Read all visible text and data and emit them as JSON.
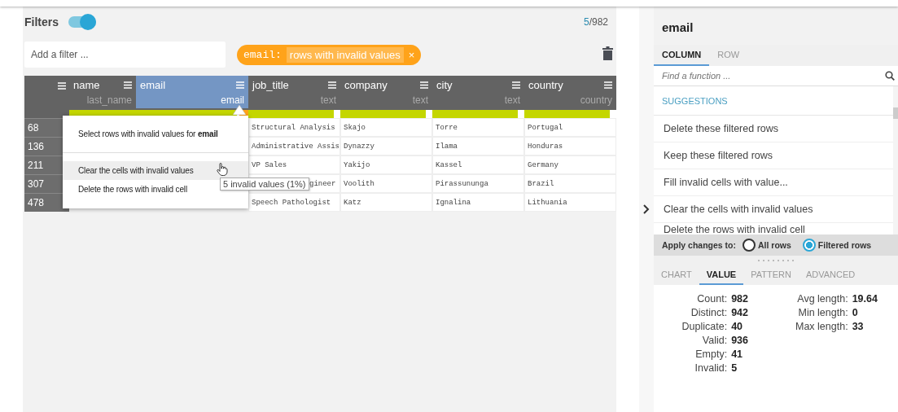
{
  "filters": {
    "label": "Filters",
    "on": true,
    "matched": "5",
    "total": "/982",
    "input": {
      "placeholder": "Add a filter ..."
    },
    "chips": [
      {
        "column": "email:",
        "value": "rows with invalid values",
        "close": "×"
      }
    ]
  },
  "table": {
    "columns": [
      {
        "name": "name",
        "type": "last_name",
        "selected": false,
        "valid": {
          "level": 1
        }
      },
      {
        "name": "email",
        "type": "email",
        "selected": true,
        "valid": {
          "level": 0.9
        },
        "invalid": {
          "level": 0.08
        }
      },
      {
        "name": "job_title",
        "type": "text",
        "selected": false,
        "valid": {
          "level": 0.93
        }
      },
      {
        "name": "company",
        "type": "text",
        "selected": false,
        "valid": {
          "level": 0.93
        }
      },
      {
        "name": "city",
        "type": "text",
        "selected": false,
        "valid": {
          "level": 0.93
        }
      },
      {
        "name": "country",
        "type": "country",
        "selected": false,
        "valid": {
          "level": 0.93
        }
      }
    ],
    "rows": [
      {
        "index": "68",
        "cells": [
          "",
          "",
          "Structural Analysis",
          "Skajo",
          "Torre",
          "Portugal"
        ],
        "under_tooltip": false
      },
      {
        "index": "136",
        "cells": [
          "",
          "",
          "Administrative Assis",
          "Dynazzy",
          "Ilama",
          "Honduras"
        ],
        "under_tooltip": false
      },
      {
        "index": "211",
        "cells": [
          "",
          "",
          "VP Sales",
          "Yakijo",
          "Kassel",
          "Germany"
        ],
        "under_tooltip": false
      },
      {
        "index": "307",
        "cells": [
          "",
          "",
          "gineer",
          "Voolith",
          "Pirassununga",
          "Brazil"
        ],
        "under_tooltip": true
      },
      {
        "index": "478",
        "cells": [
          "",
          "",
          "Speech Pathologist",
          "Katz",
          "Ignalina",
          "Lithuania"
        ],
        "under_tooltip": false
      }
    ]
  },
  "menu": {
    "items": [
      {
        "text": "Select rows with invalid values for **email**",
        "hovered": false,
        "separator_after": true
      },
      {
        "text": "Clear the cells with invalid values",
        "hovered": true,
        "separator_after": false
      },
      {
        "text": "Delete the rows with invalid cell",
        "hovered": false,
        "separator_after": false
      }
    ],
    "tooltip": "5 invalid values (1%)"
  },
  "panel": {
    "title": "email",
    "tabs": [
      {
        "label": "COLUMN",
        "selected": true
      },
      {
        "label": "ROW",
        "selected": false
      }
    ],
    "search": {
      "placeholder": "Find a function ..."
    },
    "suggestions_header": "SUGGESTIONS",
    "suggestions": [
      "Delete these filtered rows",
      "Keep these filtered rows",
      "Fill invalid cells with value...",
      "Clear the cells with invalid values",
      "Delete the rows with invalid cell"
    ],
    "apply": {
      "label": "Apply changes to:",
      "options": [
        {
          "label": "All rows",
          "selected": false
        },
        {
          "label": "Filtered rows",
          "selected": true
        }
      ]
    },
    "stat_tabs": [
      {
        "label": "CHART",
        "selected": false
      },
      {
        "label": "VALUE",
        "selected": true
      },
      {
        "label": "PATTERN",
        "selected": false
      },
      {
        "label": "ADVANCED",
        "selected": false
      }
    ],
    "stats_left": [
      {
        "label": "Count:",
        "value": "982"
      },
      {
        "label": "Distinct:",
        "value": "942"
      },
      {
        "label": "Duplicate:",
        "value": "40"
      },
      {
        "label": "Valid:",
        "value": "936"
      },
      {
        "label": "Empty:",
        "value": "41"
      },
      {
        "label": "Invalid:",
        "value": "5"
      }
    ],
    "stats_right": [
      {
        "label": "Avg length:",
        "value": "19.64"
      },
      {
        "label": "Min length:",
        "value": "0"
      },
      {
        "label": "Max length:",
        "value": "33"
      }
    ]
  }
}
